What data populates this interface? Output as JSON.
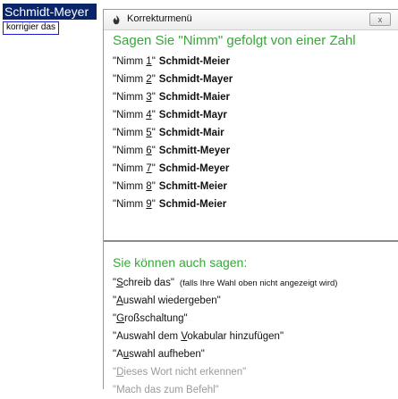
{
  "document": {
    "selected_word": "Schmidt-Meyer",
    "tooltip": "korrigier das"
  },
  "window": {
    "title": "Korrekturmenü",
    "close_label": "x"
  },
  "section1": {
    "heading": "Sagen Sie \"Nimm\" gefolgt von einer Zahl",
    "items": [
      {
        "prefix": "\"Nimm ",
        "num": "1",
        "suffix": "\"",
        "name": "Schmidt-Meier"
      },
      {
        "prefix": "\"Nimm ",
        "num": "2",
        "suffix": "\"",
        "name": "Schmidt-Mayer"
      },
      {
        "prefix": "\"Nimm ",
        "num": "3",
        "suffix": "\"",
        "name": "Schmidt-Maier"
      },
      {
        "prefix": "\"Nimm ",
        "num": "4",
        "suffix": "\"",
        "name": "Schmidt-Mayr"
      },
      {
        "prefix": "\"Nimm ",
        "num": "5",
        "suffix": "\"",
        "name": "Schmidt-Mair"
      },
      {
        "prefix": "\"Nimm ",
        "num": "6",
        "suffix": "\"",
        "name": "Schmitt-Meyer"
      },
      {
        "prefix": "\"Nimm ",
        "num": "7",
        "suffix": "\"",
        "name": "Schmid-Meyer"
      },
      {
        "prefix": "\"Nimm ",
        "num": "8",
        "suffix": "\"",
        "name": "Schmitt-Meier"
      },
      {
        "prefix": "\"Nimm ",
        "num": "9",
        "suffix": "\"",
        "name": "Schmid-Meier"
      }
    ]
  },
  "section2": {
    "heading": "Sie können auch sagen:",
    "commands": [
      {
        "pre": "\"",
        "u": "S",
        "post": "chreib das\"",
        "note": "(falls Ihre Wahl oben nicht angezeigt wird)",
        "disabled": false
      },
      {
        "pre": "\"",
        "u": "A",
        "post": "uswahl wiedergeben\"",
        "note": "",
        "disabled": false
      },
      {
        "pre": "\"",
        "u": "G",
        "post": "roßschaltung\"",
        "note": "",
        "disabled": false
      },
      {
        "pre": "\"Auswahl dem ",
        "u": "V",
        "post": "okabular hinzufügen\"",
        "note": "",
        "disabled": false
      },
      {
        "pre": "\"A",
        "u": "u",
        "post": "swahl aufheben\"",
        "note": "",
        "disabled": false
      },
      {
        "pre": "\"",
        "u": "D",
        "post": "ieses Wort nicht erkennen\"",
        "note": "",
        "disabled": true
      },
      {
        "pre": "\"Mach das zum Befehl\"",
        "u": "",
        "post": "",
        "note": "",
        "disabled": true
      }
    ]
  },
  "colors": {
    "heading_green": "#36a838",
    "selection_blue": "#0a246a",
    "disabled_gray": "#9a9a9a"
  }
}
